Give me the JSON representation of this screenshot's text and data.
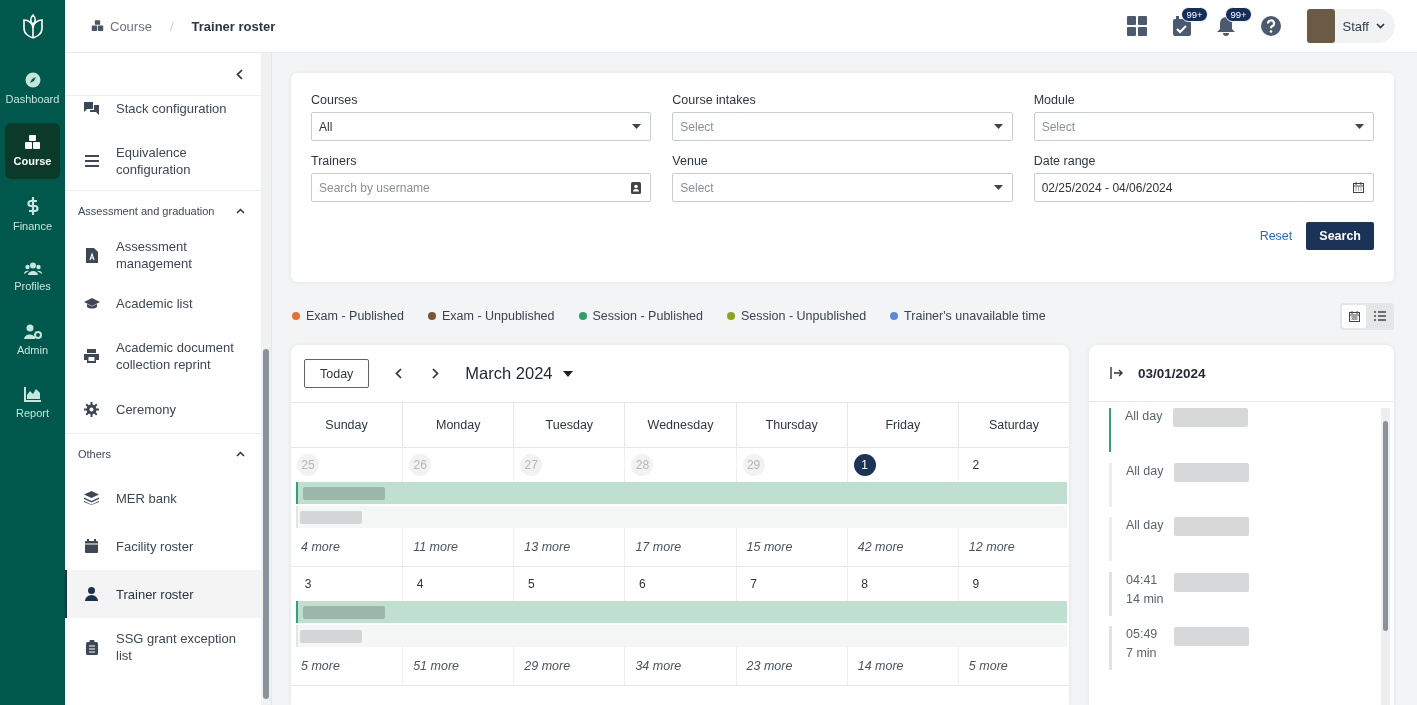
{
  "rail": {
    "items": [
      {
        "label": "Dashboard",
        "selected": false
      },
      {
        "label": "Course",
        "selected": true
      },
      {
        "label": "Finance",
        "selected": false
      },
      {
        "label": "Profiles",
        "selected": false
      },
      {
        "label": "Admin",
        "selected": false
      },
      {
        "label": "Report",
        "selected": false
      }
    ]
  },
  "breadcrumb": [
    "Course",
    "Trainer roster"
  ],
  "breadcrumb_separator": "/",
  "header_actions": {
    "tasks_badge": "99+",
    "notifications_badge": "99+",
    "user": "Staff"
  },
  "sidebar": {
    "items": [
      {
        "label": "Stack configuration",
        "selected": false
      },
      {
        "label": "Equivalence configuration",
        "selected": false
      }
    ],
    "sections": [
      {
        "title": "Assessment and graduation",
        "expanded": true,
        "items": [
          {
            "label": "Assessment management",
            "selected": false
          },
          {
            "label": "Academic list",
            "selected": false
          },
          {
            "label": "Academic document collection reprint",
            "selected": false
          },
          {
            "label": "Ceremony",
            "selected": false
          }
        ]
      },
      {
        "title": "Others",
        "expanded": true,
        "items": [
          {
            "label": "MER bank",
            "selected": false
          },
          {
            "label": "Facility roster",
            "selected": false
          },
          {
            "label": "Trainer roster",
            "selected": true
          },
          {
            "label": "SSG grant exception list",
            "selected": false
          }
        ]
      }
    ]
  },
  "filters": [
    {
      "label": "Courses",
      "kind": "select",
      "value": "All"
    },
    {
      "label": "Course intakes",
      "kind": "select",
      "placeholder": "Select"
    },
    {
      "label": "Module",
      "kind": "select",
      "placeholder": "Select"
    },
    {
      "label": "Trainers",
      "kind": "search",
      "placeholder": "Search by username"
    },
    {
      "label": "Venue",
      "kind": "select",
      "placeholder": "Select"
    },
    {
      "label": "Date range",
      "kind": "date",
      "value": "02/25/2024 - 04/06/2024"
    }
  ],
  "filter_actions": {
    "reset": "Reset",
    "search": "Search"
  },
  "legend": [
    {
      "label": "Exam - Published",
      "color": "#e8702a"
    },
    {
      "label": "Exam - Unpublished",
      "color": "#7b5535"
    },
    {
      "label": "Session - Published",
      "color": "#2e9e6a"
    },
    {
      "label": "Session - Unpublished",
      "color": "#8aa51a"
    },
    {
      "label": "Trainer's unavailable time",
      "color": "#5b8bd6"
    }
  ],
  "view_toggle": [
    {
      "kind": "calendar",
      "selected": true
    },
    {
      "kind": "list",
      "selected": false
    }
  ],
  "calendar": {
    "today_button": "Today",
    "month": "March 2024",
    "weekdays": [
      "Sunday",
      "Monday",
      "Tuesday",
      "Wednesday",
      "Thursday",
      "Friday",
      "Saturday"
    ],
    "weeks": [
      {
        "days": [
          {
            "date": "25",
            "outside": true,
            "selected": false
          },
          {
            "date": "26",
            "outside": true,
            "selected": false
          },
          {
            "date": "27",
            "outside": true,
            "selected": false
          },
          {
            "date": "28",
            "outside": true,
            "selected": false
          },
          {
            "date": "29",
            "outside": true,
            "selected": false
          },
          {
            "date": "1",
            "outside": false,
            "selected": true
          },
          {
            "date": "2",
            "outside": false,
            "selected": false
          }
        ],
        "more": [
          "4 more",
          "11 more",
          "13 more",
          "17 more",
          "15 more",
          "42 more",
          "12 more"
        ]
      },
      {
        "days": [
          {
            "date": "3",
            "outside": false,
            "selected": false
          },
          {
            "date": "4",
            "outside": false,
            "selected": false
          },
          {
            "date": "5",
            "outside": false,
            "selected": false
          },
          {
            "date": "6",
            "outside": false,
            "selected": false
          },
          {
            "date": "7",
            "outside": false,
            "selected": false
          },
          {
            "date": "8",
            "outside": false,
            "selected": false
          },
          {
            "date": "9",
            "outside": false,
            "selected": false
          }
        ],
        "more": [
          "5 more",
          "51 more",
          "29 more",
          "34 more",
          "23 more",
          "14 more",
          "5 more"
        ]
      }
    ]
  },
  "day_panel": {
    "date": "03/01/2024",
    "events": [
      {
        "time": "All day",
        "color": "#3a9f74"
      },
      {
        "time": "All day",
        "color": "#eceef0"
      },
      {
        "time": "All day",
        "color": "#eceef0"
      },
      {
        "time": "04:41",
        "duration": "14 min",
        "color": "#e0e2e5"
      },
      {
        "time": "05:49",
        "duration": "7 min",
        "color": "#e0e2e5"
      }
    ]
  }
}
